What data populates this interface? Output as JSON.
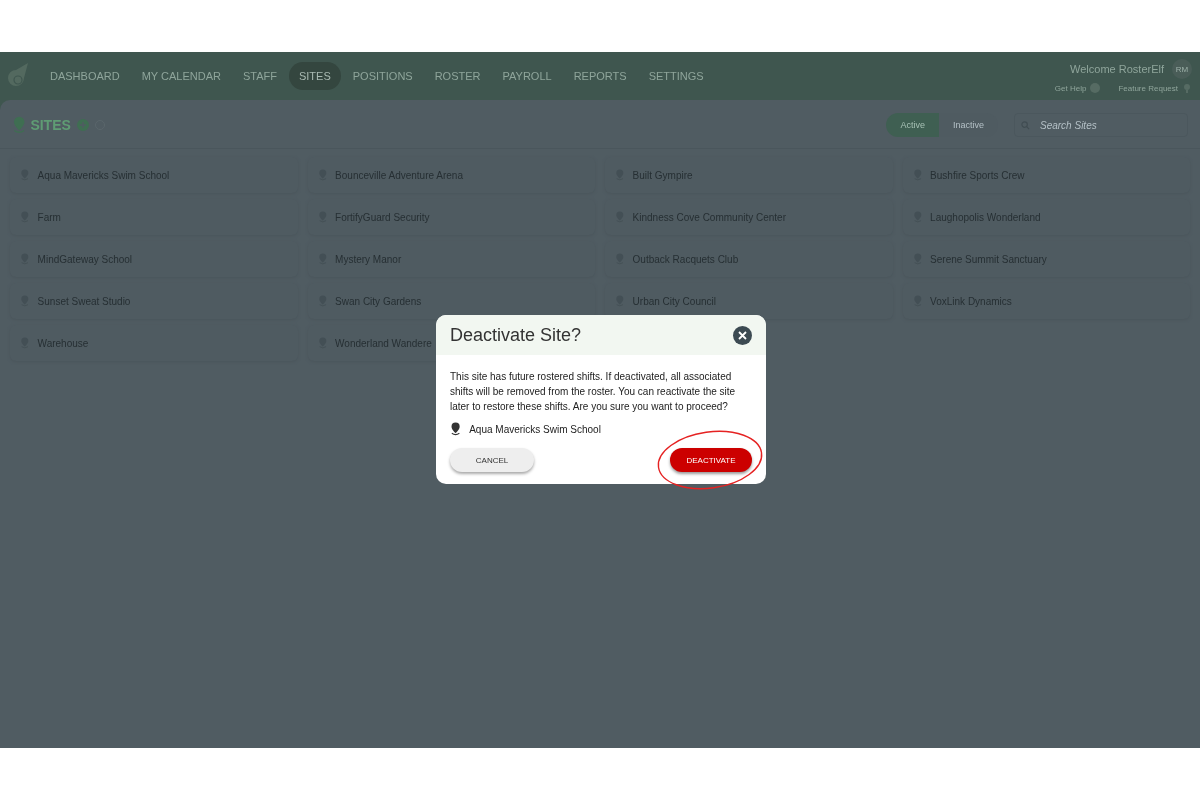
{
  "nav": [
    {
      "label": "DASHBOARD",
      "selected": false
    },
    {
      "label": "MY CALENDAR",
      "selected": false
    },
    {
      "label": "STAFF",
      "selected": false
    },
    {
      "label": "SITES",
      "selected": true
    },
    {
      "label": "POSITIONS",
      "selected": false
    },
    {
      "label": "ROSTER",
      "selected": false
    },
    {
      "label": "PAYROLL",
      "selected": false
    },
    {
      "label": "REPORTS",
      "selected": false
    },
    {
      "label": "SETTINGS",
      "selected": false
    }
  ],
  "user": {
    "welcome": "Welcome RosterElf",
    "initials": "RM"
  },
  "links": [
    {
      "kind": "help",
      "label": "Get Help"
    },
    {
      "kind": "idea",
      "label": "Feature Request"
    }
  ],
  "page": {
    "title": "SITES"
  },
  "filter": [
    {
      "label": "Active",
      "selected": true
    },
    {
      "label": "Inactive",
      "selected": false
    }
  ],
  "search": {
    "placeholder": "Search Sites"
  },
  "sites": [
    "Aqua Mavericks Swim School",
    "Bounceville Adventure Arena",
    "Built Gympire",
    "Bushfire Sports Crew",
    "Farm",
    "FortifyGuard Security",
    "Kindness Cove Community Center",
    "Laughopolis Wonderland",
    "MindGateway School",
    "Mystery Manor",
    "Outback Racquets Club",
    "Serene Summit Sanctuary",
    "Sunset Sweat Studio",
    "Swan City Gardens",
    "Urban City Council",
    "VoxLink Dynamics",
    "Warehouse",
    "Wonderland Wandere"
  ],
  "dialog": {
    "title": "Deactivate Site?",
    "message": "This site has future rostered shifts. If deactivated, all associated shifts will be removed from the roster. You can reactivate the site later to restore these shifts. Are you sure you want to proceed?",
    "site": "Aqua Mavericks Swim School",
    "cancel": "CANCEL",
    "confirm": "DEACTIVATE"
  }
}
